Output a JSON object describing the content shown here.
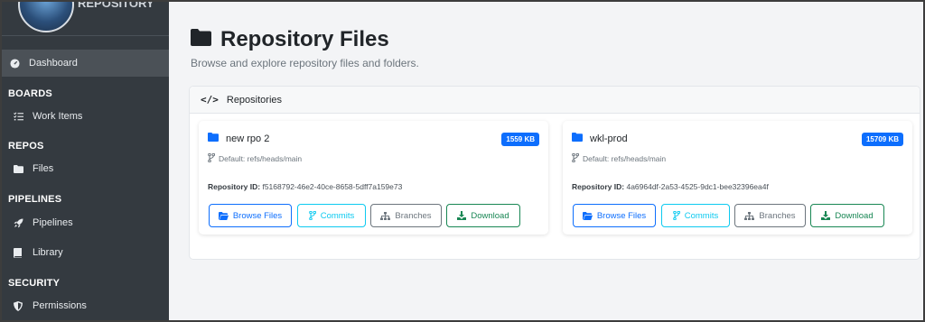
{
  "sidebar": {
    "logo_text": "REPOSITORY",
    "dashboard": "Dashboard",
    "sections": {
      "boards": "BOARDS",
      "repos": "REPOS",
      "pipelines": "PIPELINES",
      "security": "SECURITY"
    },
    "items": {
      "work_items": "Work Items",
      "files": "Files",
      "pipelines": "Pipelines",
      "library": "Library",
      "permissions": "Permissions"
    }
  },
  "page": {
    "title": "Repository Files",
    "subtitle": "Browse and explore repository files and folders."
  },
  "card": {
    "header": "Repositories"
  },
  "repos": [
    {
      "name": "new rpo 2",
      "size": "1559 KB",
      "branch": "Default: refs/heads/main",
      "id_label": "Repository ID:",
      "id": "f5168792-46e2-40ce-8658-5dff7a159e73"
    },
    {
      "name": "wkl-prod",
      "size": "15709 KB",
      "branch": "Default: refs/heads/main",
      "id_label": "Repository ID:",
      "id": "4a6964df-2a53-4525-9dc1-bee32396ea4f"
    }
  ],
  "buttons": {
    "browse": "Browse Files",
    "commits": "Commits",
    "branches": "Branches",
    "download": "Download"
  },
  "colors": {
    "sidebar_bg": "#343a40",
    "primary": "#0d6efd",
    "info": "#0dcaf0",
    "secondary": "#6c757d",
    "success": "#198754"
  }
}
